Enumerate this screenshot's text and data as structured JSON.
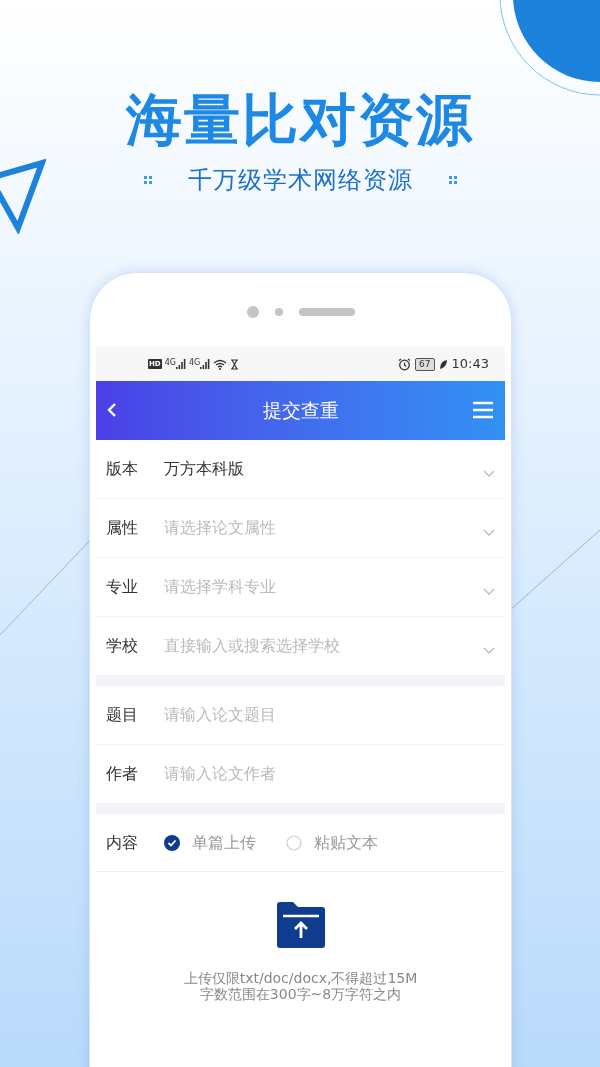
{
  "banner": {
    "title": "海量比对资源",
    "subtitle": "千万级学术网络资源"
  },
  "status_bar": {
    "hd": "HD",
    "networks": [
      "4G",
      "4G"
    ],
    "battery": "67",
    "time": "10:43"
  },
  "header": {
    "title": "提交查重"
  },
  "sections": [
    {
      "rows": [
        {
          "kind": "select",
          "label": "版本",
          "value": "万方本科版"
        },
        {
          "kind": "select",
          "label": "属性",
          "placeholder": "请选择论文属性"
        },
        {
          "kind": "select",
          "label": "专业",
          "placeholder": "请选择学科专业"
        },
        {
          "kind": "select",
          "label": "学校",
          "placeholder": "直接输入或搜索选择学校"
        }
      ]
    },
    {
      "rows": [
        {
          "kind": "input",
          "label": "题目",
          "placeholder": "请输入论文题目"
        },
        {
          "kind": "input",
          "label": "作者",
          "placeholder": "请输入论文作者"
        }
      ]
    }
  ],
  "content": {
    "label": "内容",
    "options": [
      {
        "label": "单篇上传",
        "selected": true
      },
      {
        "label": "粘贴文本",
        "selected": false
      }
    ],
    "upload_hint": [
      "上传仅限txt/doc/docx,不得超过15M",
      "字数范围在300字~8万字符之内"
    ]
  }
}
